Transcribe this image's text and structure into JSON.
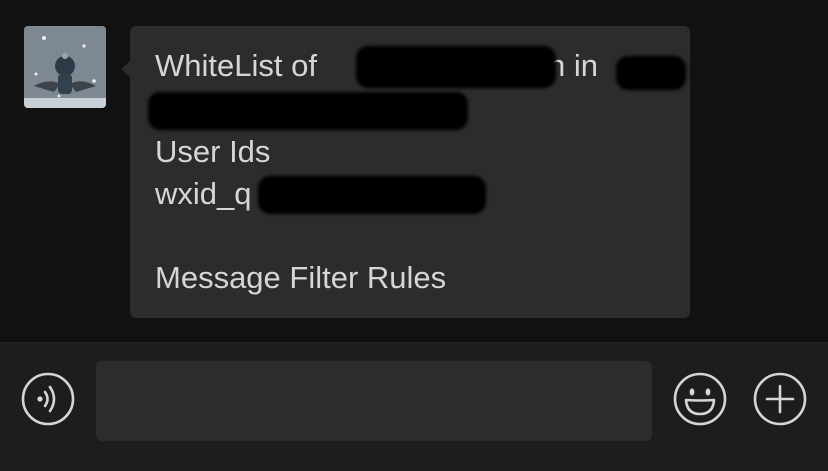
{
  "message": {
    "title_line": "WhiteList of",
    "title_suffix": "n in",
    "section_user_ids": "User Ids",
    "user_id_prefix": "wxid_q",
    "footer_line": "Message Filter Rules"
  },
  "input_bar": {
    "text_value": "",
    "icons": {
      "voice": "voice-icon",
      "emoji": "emoji-icon",
      "more": "plus-icon"
    }
  },
  "colors": {
    "background": "#111111",
    "bubble": "#2c2c2c",
    "text": "#d6d6d6",
    "input_bar": "#1d1d1d"
  }
}
